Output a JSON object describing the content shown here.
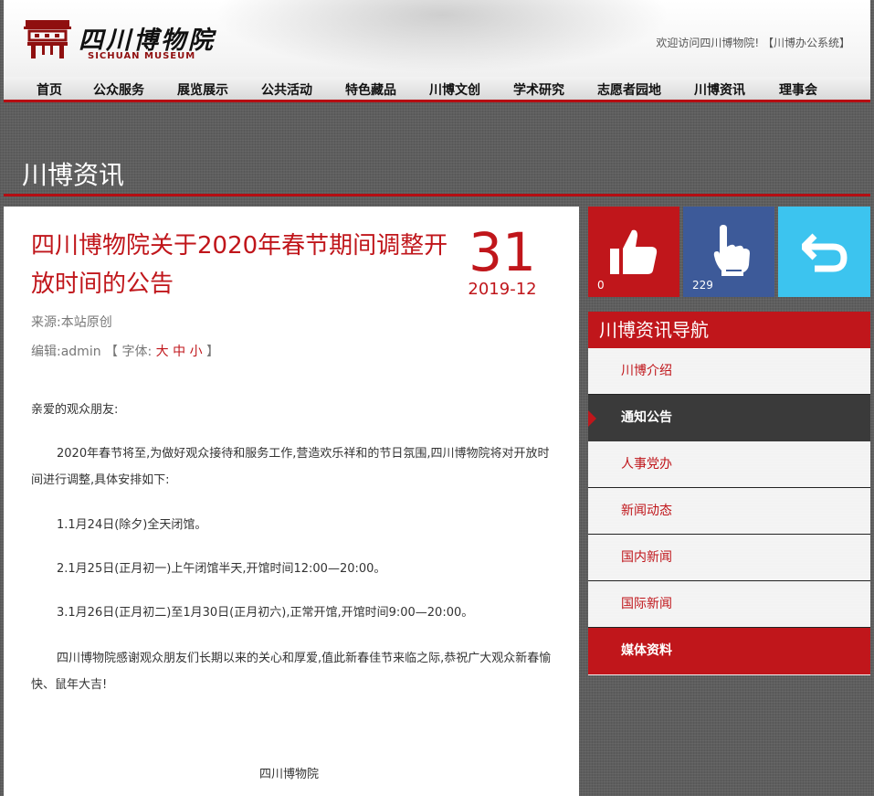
{
  "header": {
    "logo_cn": "四川博物院",
    "logo_en": "SICHUAN MUSEUM",
    "welcome": "欢迎访问四川博物院!",
    "office_link": "【川博办公系统】"
  },
  "nav": {
    "items": [
      "首页",
      "公众服务",
      "展览展示",
      "公共活动",
      "特色藏品",
      "川博文创",
      "学术研究",
      "志愿者园地",
      "川博资讯",
      "理事会"
    ]
  },
  "section": {
    "title": "川博资讯"
  },
  "article": {
    "title": "四川博物院关于2020年春节期间调整开放时间的公告",
    "date_day": "31",
    "date_ym": "2019-12",
    "source": "来源:本站原创",
    "editor_label": "编辑:admin",
    "font_label_open": "【 字体:",
    "font_large": "大",
    "font_medium": "中",
    "font_small": "小",
    "font_label_close": "】",
    "greeting": "亲爱的观众朋友:",
    "p1": "2020年春节将至,为做好观众接待和服务工作,营造欢乐祥和的节日氛围,四川博物院将对开放时间进行调整,具体安排如下:",
    "p2": "1.1月24日(除夕)全天闭馆。",
    "p3": "2.1月25日(正月初一)上午闭馆半天,开馆时间12:00—20:00。",
    "p4": "3.1月26日(正月初二)至1月30日(正月初六),正常开馆,开馆时间9:00—20:00。",
    "p5": "四川博物院感谢观众朋友们长期以来的关心和厚爱,值此新春佳节来临之际,恭祝广大观众新春愉快、鼠年大吉!",
    "signature": "四川博物院"
  },
  "tiles": {
    "like_count": "0",
    "click_count": "229",
    "like_color": "#c0161b",
    "click_color": "#3d5a99",
    "back_color": "#3cc4ef"
  },
  "sidebar": {
    "title": "川博资讯导航",
    "items": [
      "川博介绍",
      "通知公告",
      "人事党办",
      "新闻动态",
      "国内新闻",
      "国际新闻",
      "媒体资料"
    ],
    "active_index": 1
  }
}
